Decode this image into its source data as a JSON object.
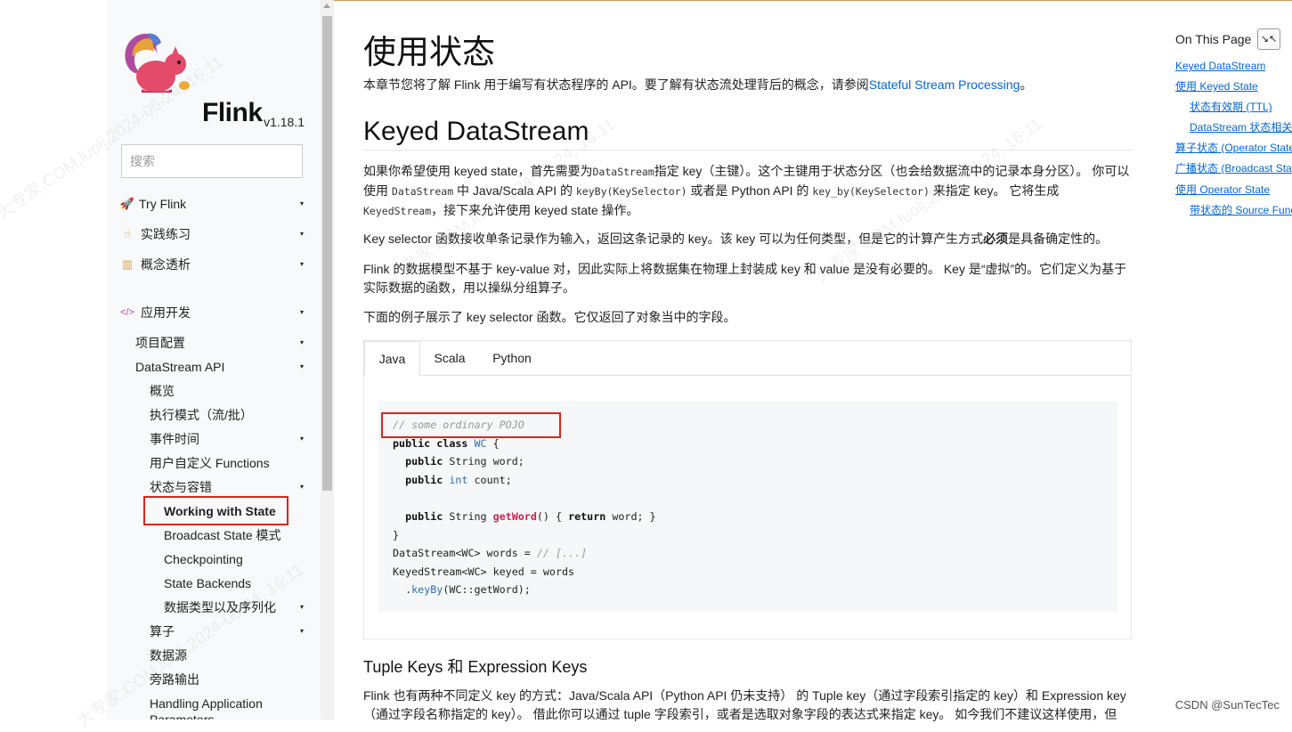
{
  "brand": {
    "name": "Flink",
    "version": "v1.18.1"
  },
  "search": {
    "placeholder": "搜索"
  },
  "sidebar": {
    "items": [
      {
        "label": "Try Flink",
        "icon": "rocket-icon"
      },
      {
        "label": "实践练习",
        "icon": "hand-pointer-icon"
      },
      {
        "label": "概念透析",
        "icon": "map-icon"
      },
      {
        "label": "应用开发",
        "icon": "code-icon"
      },
      {
        "label": "项目配置"
      },
      {
        "label": "DataStream API"
      },
      {
        "label": "概览"
      },
      {
        "label": "执行模式（流/批）"
      },
      {
        "label": "事件时间"
      },
      {
        "label": "用户自定义 Functions"
      },
      {
        "label": "状态与容错"
      },
      {
        "label": "Working with State"
      },
      {
        "label": "Broadcast State 模式"
      },
      {
        "label": "Checkpointing"
      },
      {
        "label": "State Backends"
      },
      {
        "label": "数据类型以及序列化"
      },
      {
        "label": "算子"
      },
      {
        "label": "数据源"
      },
      {
        "label": "旁路输出"
      },
      {
        "label": "Handling Application Parameters"
      }
    ],
    "caret": "▾"
  },
  "content": {
    "title": "使用状态",
    "intro": "本章节您将了解 Flink 用于编写有状态程序的 API。要了解有状态流处理背后的概念，请参阅",
    "intro_link": "Stateful Stream Processing",
    "intro_end": "。",
    "section_title": "Keyed DataStream",
    "p1": {
      "a": "如果你希望使用 keyed state，首先需要为",
      "code1": "DataStream",
      "b": "指定 key（主键）。这个主键用于状态分区（也会给数据流中的记录本身分区）。 你可以使用 ",
      "code2": "DataStream",
      "c": " 中 Java/Scala API 的 ",
      "code3": "keyBy(KeySelector)",
      "d": " 或者是 Python API 的 ",
      "code4": "key_by(KeySelector)",
      "e": " 来指定 key。 它将生成 ",
      "code5": "KeyedStream",
      "f": "，接下来允许使用 keyed state 操作。"
    },
    "p2": {
      "a": "Key selector 函数接收单条记录作为输入，返回这条记录的 key。该 key 可以为任何类型，但是它的计算产生方式",
      "b": "必须",
      "c": "是具备确定性的。"
    },
    "p3": "Flink 的数据模型不基于 key-value 对，因此实际上将数据集在物理上封装成 key 和 value 是没有必要的。 Key 是“虚拟”的。它们定义为基于实际数据的函数，用以操纵分组算子。",
    "p4": "下面的例子展示了 key selector 函数。它仅返回了对象当中的字段。",
    "tabs": [
      "Java",
      "Scala",
      "Python"
    ],
    "subsection_title": "Tuple Keys 和 Expression Keys",
    "p5": "Flink 也有两种不同定义 key 的方式：Java/Scala API（Python API 仍未支持） 的 Tuple key（通过字段索引指定的 key）和 Expression key（通过字段名称指定的 key）。 借此你可以通过 tuple 字段索引，或者是选取对象字段的表达式来指定 key。 如今我们不建议这样使用，但"
  },
  "code": {
    "comment": "// some ordinary POJO",
    "l2": {
      "kw": "public class",
      "type": "WC",
      "end": " {"
    },
    "l3": {
      "kw": "public",
      "rest": " String word;"
    },
    "l4": {
      "kw1": "public",
      "kw2": "int",
      "rest": " count;"
    },
    "l6": {
      "kw": "public",
      "a": " String ",
      "fn": "getWord",
      "b": "() { ",
      "kw2": "return",
      "c": " word; }"
    },
    "l7": "}",
    "l8": {
      "a": "DataStream<WC> words = ",
      "cm": "// [...]"
    },
    "l9": "KeyedStream<WC> keyed = words",
    "l10": {
      "a": "  .",
      "fn": "keyBy",
      "b": "(WC::getWord);"
    }
  },
  "toc": {
    "title": "On This Page",
    "collapse_icon": "collapse-icon",
    "links": [
      "Keyed DataStream",
      "使用 Keyed State",
      "状态有效期 (TTL)",
      "DataStream 状态相关",
      "算子状态 (Operator State",
      "广播状态 (Broadcast Sta",
      "使用 Operator State",
      "带状态的 Source Func"
    ]
  },
  "watermark": {
    "text": "大专家.COM,luolj,2024-06-24, 16:11"
  },
  "credit": "CSDN @SunTecTec",
  "colors": {
    "link": "#0366d6",
    "highlight": "#d9261c",
    "sidebar_bg": "#f8f9fa"
  }
}
